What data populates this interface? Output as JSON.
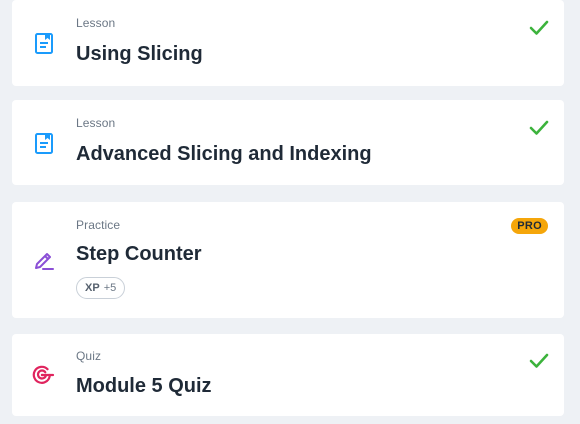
{
  "items": [
    {
      "type": "Lesson",
      "title": "Using Slicing",
      "icon": "lesson-icon",
      "completed": true
    },
    {
      "type": "Lesson",
      "title": "Advanced Slicing and Indexing",
      "icon": "lesson-icon",
      "completed": true
    },
    {
      "type": "Practice",
      "title": "Step Counter",
      "icon": "practice-icon",
      "badge": "PRO",
      "xp_label": "XP",
      "xp_value": "+5",
      "completed": false
    },
    {
      "type": "Quiz",
      "title": "Module 5 Quiz",
      "icon": "quiz-icon",
      "completed": true
    }
  ],
  "colors": {
    "lesson_icon": "#1a9bfc",
    "practice_icon": "#8b4fd6",
    "quiz_icon": "#e0245e",
    "check": "#3cb33c",
    "pro_badge": "#f5a60a"
  }
}
